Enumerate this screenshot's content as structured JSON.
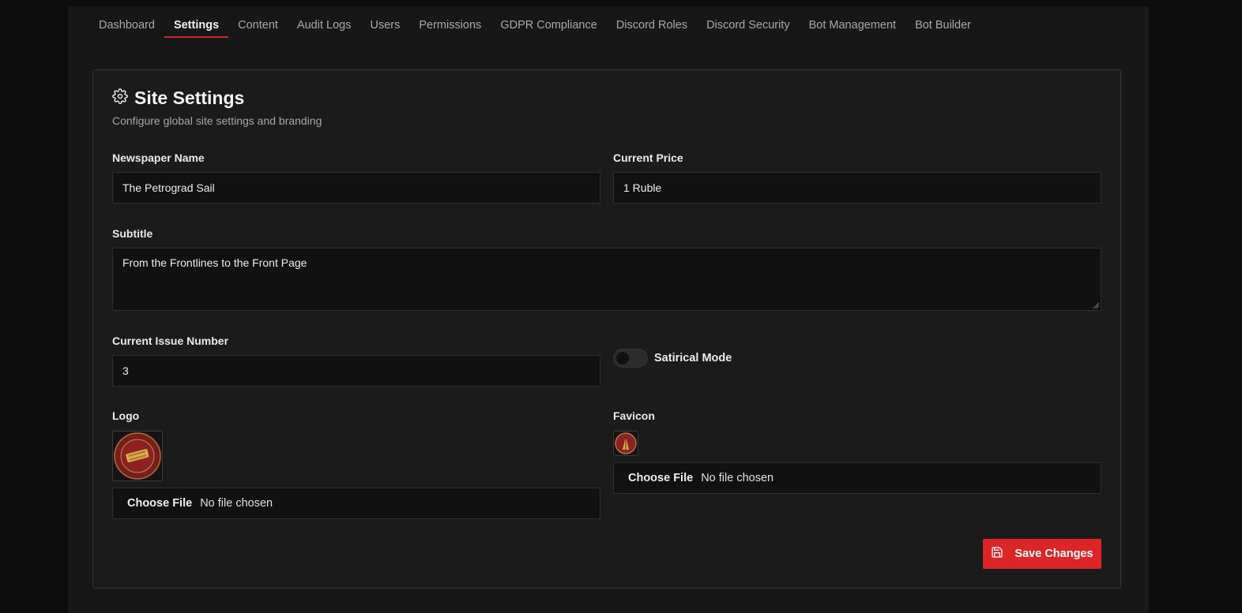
{
  "nav": {
    "tabs": [
      {
        "label": "Dashboard"
      },
      {
        "label": "Settings"
      },
      {
        "label": "Content"
      },
      {
        "label": "Audit Logs"
      },
      {
        "label": "Users"
      },
      {
        "label": "Permissions"
      },
      {
        "label": "GDPR Compliance"
      },
      {
        "label": "Discord Roles"
      },
      {
        "label": "Discord Security"
      },
      {
        "label": "Bot Management"
      },
      {
        "label": "Bot Builder"
      }
    ],
    "active_tab": "Settings"
  },
  "card": {
    "title": "Site Settings",
    "icon": "gear-icon",
    "subtitle": "Configure global site settings and branding"
  },
  "form": {
    "newspaper_name": {
      "label": "Newspaper Name",
      "value": "The Petrograd Sail"
    },
    "current_price": {
      "label": "Current Price",
      "value": "1 Ruble"
    },
    "subtitle": {
      "label": "Subtitle",
      "value": "From the Frontlines to the Front Page"
    },
    "issue_number": {
      "label": "Current Issue Number",
      "value": "3"
    },
    "satirical_mode": {
      "label": "Satirical Mode",
      "enabled": false
    },
    "logo": {
      "label": "Logo",
      "choose_label": "Choose File",
      "status": "No file chosen"
    },
    "favicon": {
      "label": "Favicon",
      "choose_label": "Choose File",
      "status": "No file chosen"
    }
  },
  "actions": {
    "save_label": "Save Changes",
    "save_icon": "save-icon"
  },
  "colors": {
    "accent": "#dc2626",
    "background": "#171717",
    "card": "#1b1b1b",
    "input": "#111111"
  }
}
